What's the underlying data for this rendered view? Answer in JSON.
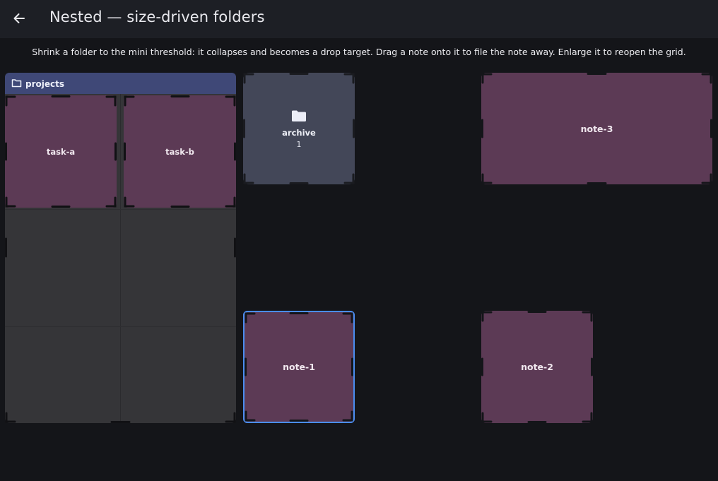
{
  "header": {
    "title": "Nested — size-driven folders",
    "back_icon": "arrow-left-icon"
  },
  "hint": "Shrink a folder to the mini threshold: it collapses and becomes a drop target. Drag a note onto it to file the note away. Enlarge it to reopen the grid.",
  "folder": {
    "name": "projects",
    "icon": "folder-outline-icon",
    "children": [
      {
        "label": "task-a"
      },
      {
        "label": "task-b"
      }
    ]
  },
  "mini_folder": {
    "name": "archive",
    "count": "1",
    "icon": "folder-filled-icon"
  },
  "notes": [
    {
      "label": "note-1",
      "selected": true
    },
    {
      "label": "note-2",
      "selected": false
    },
    {
      "label": "note-3",
      "selected": false
    }
  ],
  "colors": {
    "background": "#141519",
    "appbar": "#1d1f25",
    "note": "#5c3a55",
    "folder_header": "#3f4877",
    "folder_body": "#353538",
    "mini_folder": "#434758",
    "selection": "#4a8df0"
  }
}
